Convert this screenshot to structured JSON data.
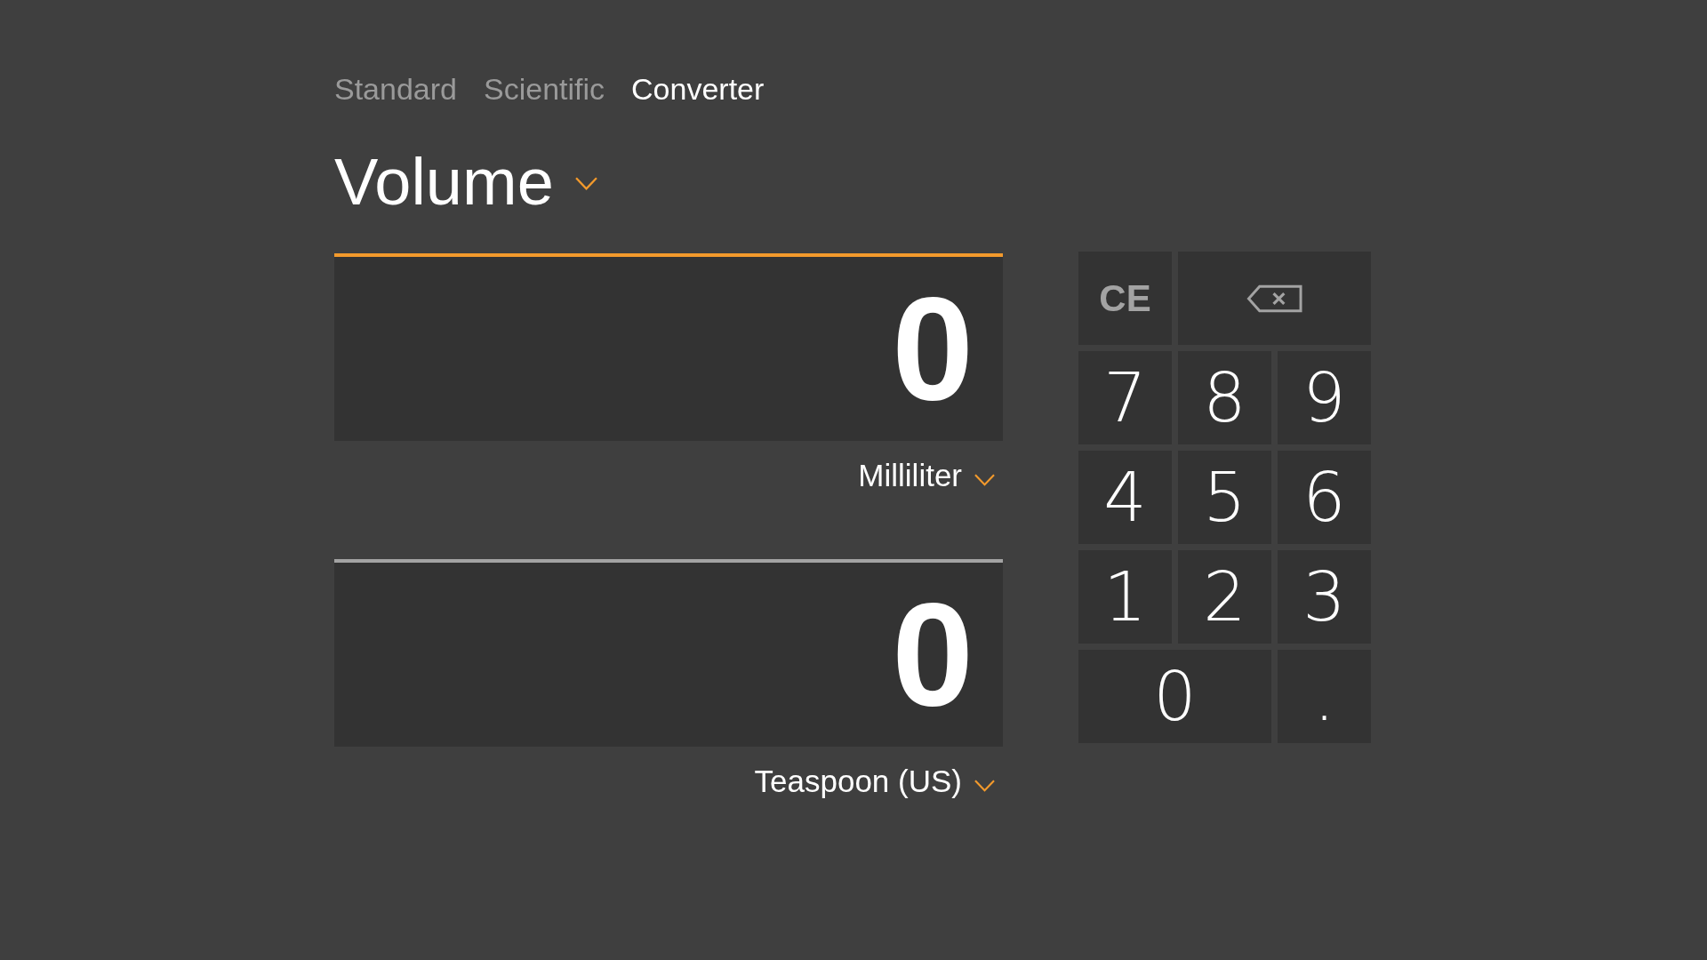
{
  "tabs": [
    {
      "label": "Standard",
      "selected": false
    },
    {
      "label": "Scientific",
      "selected": false
    },
    {
      "label": "Converter",
      "selected": true
    }
  ],
  "category": {
    "label": "Volume"
  },
  "fields": [
    {
      "value": "0",
      "unit": "Milliliter",
      "selected": true
    },
    {
      "value": "0",
      "unit": "Teaspoon (US)",
      "selected": false
    }
  ],
  "keypad": {
    "keys": [
      {
        "kind": "clear",
        "label": "CE",
        "wide": false,
        "disabled": true
      },
      {
        "kind": "backspace",
        "wide": true,
        "disabled": true
      },
      {
        "kind": "digit",
        "label": "7",
        "wide": false,
        "disabled": false
      },
      {
        "kind": "digit",
        "label": "8",
        "wide": false,
        "disabled": false
      },
      {
        "kind": "digit",
        "label": "9",
        "wide": false,
        "disabled": false
      },
      {
        "kind": "digit",
        "label": "4",
        "wide": false,
        "disabled": false
      },
      {
        "kind": "digit",
        "label": "5",
        "wide": false,
        "disabled": false
      },
      {
        "kind": "digit",
        "label": "6",
        "wide": false,
        "disabled": false
      },
      {
        "kind": "digit",
        "label": "1",
        "wide": false,
        "disabled": false
      },
      {
        "kind": "digit",
        "label": "2",
        "wide": false,
        "disabled": false
      },
      {
        "kind": "digit",
        "label": "3",
        "wide": false,
        "disabled": false
      },
      {
        "kind": "digit",
        "label": "0",
        "wide": true,
        "disabled": false
      },
      {
        "kind": "decimal",
        "label": ".",
        "wide": false,
        "disabled": false
      }
    ]
  }
}
